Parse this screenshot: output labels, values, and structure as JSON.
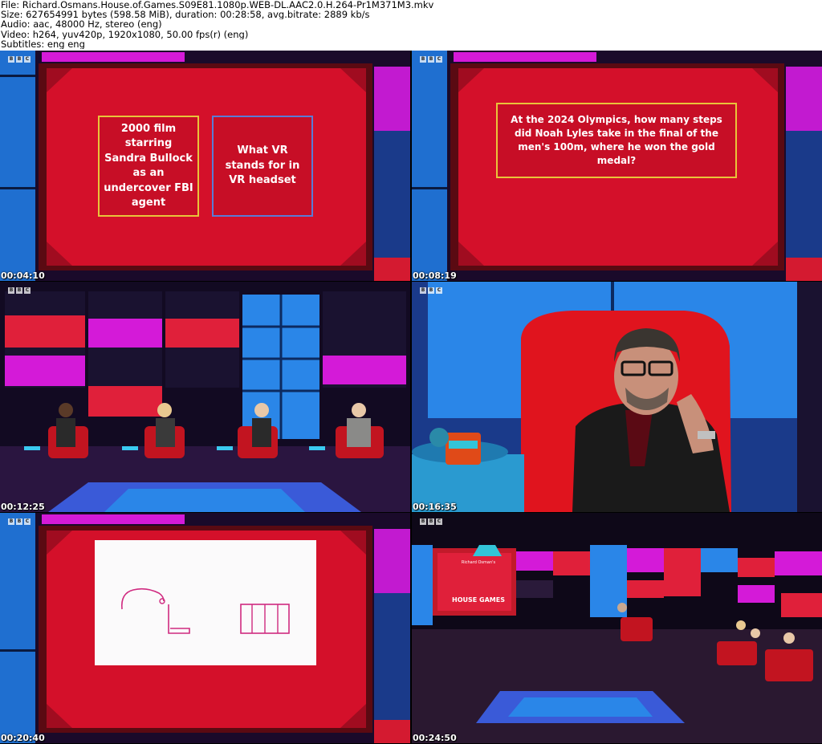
{
  "header": {
    "file": "File: Richard.Osmans.House.of.Games.S09E81.1080p.WEB-DL.AAC2.0.H.264-Pr1M371M3.mkv",
    "size": "Size: 627654991 bytes (598.58 MiB), duration: 00:28:58, avg.bitrate: 2889 kb/s",
    "audio": "Audio: aac, 48000 Hz, stereo (eng)",
    "video": "Video: h264, yuv420p, 1920x1080, 50.00 fps(r) (eng)",
    "subtitles": "Subtitles: eng eng"
  },
  "frames": [
    {
      "timestamp": "00:04:10",
      "card_left": "2000 film starring Sandra Bullock as an undercover FBI agent",
      "card_right": "What VR stands for in VR headset"
    },
    {
      "timestamp": "00:08:19",
      "question": "At the 2024 Olympics, how many steps did Noah Lyles take in the final of the men's 100m, where he won the gold medal?"
    },
    {
      "timestamp": "00:12:25"
    },
    {
      "timestamp": "00:16:35"
    },
    {
      "timestamp": "00:20:40"
    },
    {
      "timestamp": "00:24:50",
      "logo_small": "Richard Osman's",
      "logo_main": "HOUSE GAMES"
    }
  ],
  "bbc_logo": [
    "B",
    "B",
    "C"
  ],
  "colors": {
    "studio_red": "#d4102a",
    "magenta": "#d41ad8",
    "studio_blue": "#2a86e8",
    "gold_border": "#e8c43a",
    "blue_border": "#5b7bd6"
  }
}
